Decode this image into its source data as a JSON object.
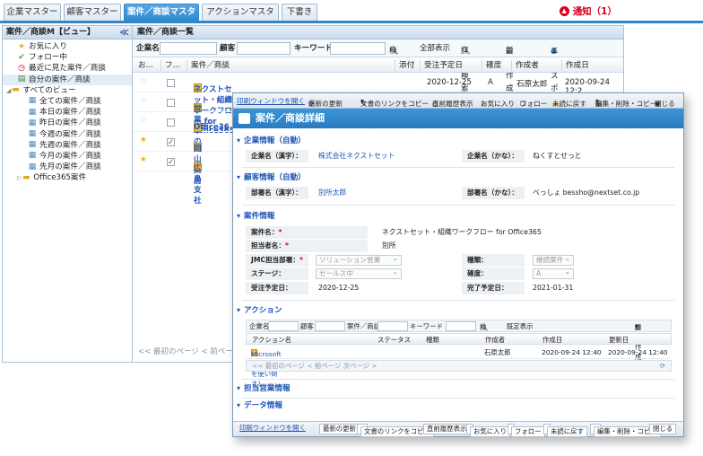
{
  "tabs": [
    "企業マスター",
    "顧客マスター",
    "案件／商談マスター",
    "アクションマスター",
    "下書き"
  ],
  "notification": {
    "label": "通知（1）"
  },
  "sidebar": {
    "title": "案件／商談M【ビュー】",
    "collapse": "≪",
    "items": [
      "お気に入り",
      "フォロー中",
      "最近に見た案件／商談",
      "自分の案件／商談",
      "すべてのビュー",
      "全ての案件／商談",
      "本日の案件／商談",
      "昨日の案件／商談",
      "今週の案件／商談",
      "先週の案件／商談",
      "今月の案件／商談",
      "先月の案件／商談",
      "Office365案件"
    ]
  },
  "main": {
    "title": "案件／商談一覧",
    "search": {
      "company": "企業名",
      "customer": "顧客",
      "keyword": "キーワード",
      "search": "検索",
      "all": "全部表示",
      "advanced": "詳細検索",
      "new": "新規作成",
      "export": "エクスポート"
    },
    "columns": [
      "お...",
      "フ...",
      "案件／商談",
      "添付",
      "受注予定日",
      "確度",
      "作成者",
      "作成日"
    ],
    "rows": [
      {
        "name": "ネクストセット・組織ワークフロー for Office365",
        "date": "2020-12-25",
        "prob": "A",
        "author": "石原太郎",
        "created": "2020-09-24 12:2",
        "starred": false,
        "checked": false
      },
      {
        "name": "営業車の",
        "starred": false,
        "checked": false
      },
      {
        "name": "Office36",
        "starred": false,
        "checked": false
      },
      {
        "name": "岡山支店",
        "starred": true,
        "checked": true
      },
      {
        "name": "広島支社",
        "starred": true,
        "checked": true
      }
    ],
    "pager": "<< 最初のページ < 前ペー"
  },
  "detail": {
    "toolbar": {
      "print": "印刷ウィンドウを開く",
      "refresh": "最新の更新",
      "copy": "文書のリンクをコピー",
      "history": "直前履歴表示",
      "fav": "お気に入り",
      "follow": "フォロー",
      "unread": "未読に戻す",
      "edit": "編集・削除・コピー",
      "close": "閉じる"
    },
    "title": "案件／商談詳細",
    "sec_company": "企業情報（自動）",
    "company_kanji_label": "企業名（漢字）：",
    "company_kanji": "株式会社ネクストセット",
    "company_kana_label": "企業名（かな）：",
    "company_kana": "ねくすとせっと",
    "sec_customer": "顧客情報（自動）",
    "dept_kanji_label": "部署名（漢字）：",
    "dept_kanji": "別所太郎",
    "dept_kana_label": "部署名（かな）：",
    "dept_kana": "べっしょ bessho@nextset.co.jp",
    "sec_deal": "案件情報",
    "deal_name_label": "案件名：",
    "deal_name": "ネクストセット・組織ワークフロー for Office365",
    "owner_label": "担当者名：",
    "owner": "別所",
    "jmc_label": "JMC担当部署：",
    "jmc": "ソリューション営業",
    "kind_label": "種類：",
    "kind": "継続案件",
    "stage_label": "ステージ：",
    "stage": "セールス中",
    "prob_label": "確度：",
    "prob": "A",
    "order_label": "受注予定日：",
    "order": "2020-12-25",
    "done_label": "完了予定日：",
    "done": "2021-01-31",
    "sec_action": "アクション",
    "a_search": {
      "company": "企業名",
      "customer": "顧客",
      "deal": "案件／商談",
      "keyword": "キーワード",
      "search": "検索",
      "all": "既定表示",
      "new": "新規作成"
    },
    "a_cols": [
      "アクション名",
      "ステータス",
      "種類",
      "作成者",
      "作成日",
      "更新日"
    ],
    "a_row": {
      "name": "Microsoft Office365を使い倒す！",
      "author": "石原太郎",
      "created": "2020-09-24 12:40",
      "updated": "2020-09-24 12:40"
    },
    "a_pager": "<< 最初のページ < 前ページ 次ページ >",
    "sec_sales": "担当営業情報",
    "sec_data": "データ情報"
  }
}
